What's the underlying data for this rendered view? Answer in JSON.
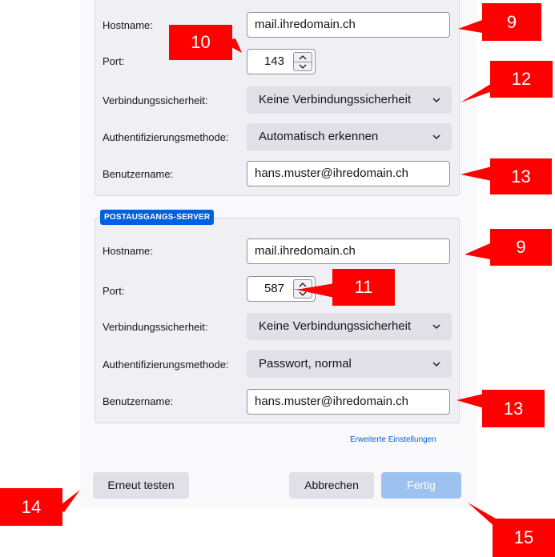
{
  "incoming": {
    "hostname_label": "Hostname:",
    "hostname_value": "mail.ihredomain.ch",
    "port_label": "Port:",
    "port_value": "143",
    "security_label": "Verbindungssicherheit:",
    "security_value": "Keine Verbindungssicherheit",
    "auth_label": "Authentifizierungsmethode:",
    "auth_value": "Automatisch erkennen",
    "username_label": "Benutzername:",
    "username_value": "hans.muster@ihredomain.ch"
  },
  "outgoing": {
    "legend": "POSTAUSGANGS-SERVER",
    "hostname_label": "Hostname:",
    "hostname_value": "mail.ihredomain.ch",
    "port_label": "Port:",
    "port_value": "587",
    "security_label": "Verbindungssicherheit:",
    "security_value": "Keine Verbindungssicherheit",
    "auth_label": "Authentifizierungsmethode:",
    "auth_value": "Passwort, normal",
    "username_label": "Benutzername:",
    "username_value": "hans.muster@ihredomain.ch"
  },
  "advanced_link": "Erweiterte Einstellungen",
  "buttons": {
    "retest": "Erneut testen",
    "cancel": "Abbrechen",
    "done": "Fertig"
  },
  "annotations": {
    "b9a": "9",
    "b10": "10",
    "b12": "12",
    "b13a": "13",
    "b9b": "9",
    "b11": "11",
    "b13b": "13",
    "b14": "14",
    "b15": "15"
  },
  "colors": {
    "annotation_red": "#ff0000",
    "accent_blue": "#0061e0",
    "disabled_button": "#9ec2f0"
  }
}
